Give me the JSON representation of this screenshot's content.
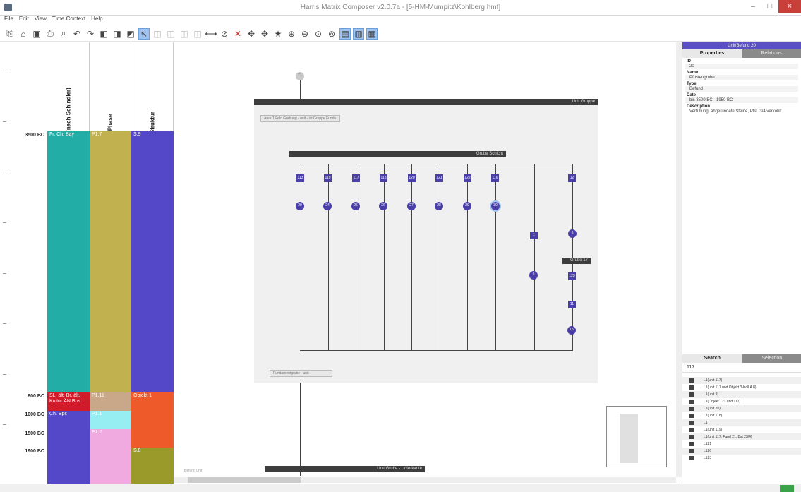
{
  "window": {
    "title": "Harris Matrix Composer v2.0.7a - [5-HM-Mumpitz\\Kohlberg.hmf]",
    "minimize": "–",
    "maximize": "□",
    "close": "×"
  },
  "menu": [
    "File",
    "Edit",
    "View",
    "Time Context",
    "Help"
  ],
  "timeline": {
    "columns": [
      "Epochen (nach Schindler)",
      "Phase",
      "Struktur"
    ],
    "dates": [
      "3500 BC",
      "800 BC",
      "1000 BC",
      "1500 BC",
      "1900 BC"
    ],
    "cells": {
      "epoch_top": "Fr. Ch. Bay",
      "epoch_mid": "SL. ält. Br. ält. Kultur ÄN Bps",
      "epoch_low": "Ch. Bps",
      "phase_top": "P1.7",
      "phase_mid": "P1.11",
      "phase_a": "P1.1",
      "phase_b": "P1.2",
      "struct_top": "S.9",
      "struct_mid": "Objekt 1",
      "struct_low": "S.8"
    }
  },
  "canvas": {
    "top_node": "T1",
    "group_bar_outer": "Unit Gruppe",
    "stub_top": "Area 1 Feld Grabung - unit - ist Gruppe Funde",
    "group_bar_inner": "Grube Schicht",
    "stub_bottom": "Fundamentgrube - unit",
    "float_bar": "Grube 17",
    "bottom_bar": "Unit Grube - Unterkante",
    "bottom_text": "Befund unit",
    "squares": [
      "113",
      "119",
      "117",
      "118",
      "120",
      "121",
      "122",
      "116",
      "1",
      "123",
      "11",
      "12"
    ],
    "circles": [
      "20",
      "24",
      "25",
      "26",
      "27",
      "28",
      "29",
      "30",
      "6",
      "9",
      "15"
    ]
  },
  "properties_panel": {
    "header": "Unit/Befund 20",
    "tabs": [
      "Properties",
      "Relations"
    ],
    "fields": [
      {
        "label": "ID",
        "value": "20"
      },
      {
        "label": "Name",
        "value": "Pfostengrube"
      },
      {
        "label": "Type",
        "value": "Befund"
      },
      {
        "label": "Date",
        "value": "bis 3500 BC - 1950 BC"
      },
      {
        "label": "Description",
        "value": "Verfüllung: abgerundete Steine, Pfst. 3/4 verkohlt"
      }
    ]
  },
  "search_panel": {
    "tabs": [
      "Search",
      "Selection"
    ],
    "query": "117",
    "results": [
      "L1(unit 117)",
      "L1(unit 117 und Objekt 3-Koll A 8)",
      "L1(unit 9)",
      "L1(Objekt 123 und 117)",
      "L1(unit 20)",
      "L1(unit 118)",
      "L1",
      "L1(unit 119)",
      "L1(unit 117, Fund 21, Bst 23/4)",
      "L121",
      "L120",
      "L123"
    ]
  },
  "colors": {
    "teal": "#22ada7",
    "olive": "#c2b14f",
    "blue": "#5448c8",
    "red": "#d01c2a",
    "tan": "#c8a888",
    "orange": "#ef5a2a",
    "cyan": "#96eef2",
    "pink": "#f0aae0",
    "olive_dark": "#9a9a2a",
    "node": "#4a3fa8"
  }
}
